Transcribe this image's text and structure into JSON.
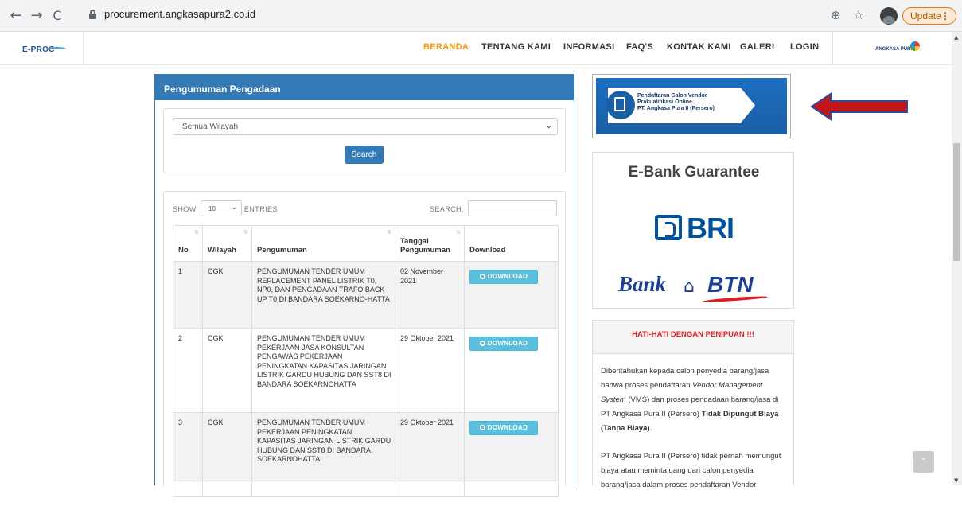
{
  "browser": {
    "back_glyph": "←",
    "forward_glyph": "→",
    "reload_glyph": "C",
    "url": "procurement.angkasapura2.co.id",
    "update_label": "Update",
    "update_menu_glyph": "⋮",
    "zoom_glyph": "⊕",
    "star_glyph": "☆"
  },
  "header": {
    "logo_text": "E-PROC",
    "right_logo_text": "ANGKASA PURA II",
    "menu": [
      {
        "label": "BERANDA",
        "active": true
      },
      {
        "label": "TENTANG KAMI"
      },
      {
        "label": "INFORMASI"
      },
      {
        "label": "FAQ'S"
      },
      {
        "label": "KONTAK KAMI"
      },
      {
        "label": "GALERI"
      },
      {
        "label": "LOGIN"
      }
    ]
  },
  "announcements": {
    "title": "Pengumuman Pengadaan",
    "region_selected": "Semua Wilayah",
    "search_button": "Search",
    "show_label": "SHOW",
    "length_selected": "10",
    "entries_label": "ENTRIES",
    "search_label": "SEARCH:",
    "columns": {
      "no": "No",
      "wilayah": "Wilayah",
      "pengumuman": "Pengumuman",
      "tanggal_1": "Tanggal",
      "tanggal_2": "Pengumuman",
      "download": "Download"
    },
    "download_label": "DOWNLOAD",
    "rows": [
      {
        "no": "1",
        "wilayah": "CGK",
        "pengumuman": "PENGUMUMAN TENDER UMUM REPLACEMENT PANEL LISTRIK T0, NP0, DAN PENGADAAN TRAFO BACK UP T0 DI BANDARA SOEKARNO-HATTA",
        "tanggal": "02 November 2021"
      },
      {
        "no": "2",
        "wilayah": "CGK",
        "pengumuman": "PENGUMUMAN TENDER UMUM PEKERJAAN JASA KONSULTAN PENGAWAS PEKERJAAN PENINGKATAN KAPASITAS JARINGAN LISTRIK GARDU HUBUNG DAN SST8 DI BANDARA SOEKARNOHATTA",
        "tanggal": "29 Oktober 2021"
      },
      {
        "no": "3",
        "wilayah": "CGK",
        "pengumuman": "PENGUMUMAN TENDER UMUM PEKERJAAN PENINGKATAN KAPASITAS JARINGAN LISTRIK GARDU HUBUNG DAN SST8 DI BANDARA SOEKARNOHATTA",
        "tanggal": "29 Oktober 2021"
      }
    ]
  },
  "sidebar": {
    "vendor_banner": {
      "line1": "Pendaftaran Calon Vendor",
      "line2": "Prakualifikasi Online",
      "line3": "PT. Angkasa Pura II (Persero)"
    },
    "ebank_title": "E-Bank Guarantee",
    "bri_text": "BRI",
    "btn_text_1": "Bank",
    "btn_text_2": "BTN",
    "warning": {
      "title": "HATI-HATI DENGAN PENIPUAN !!!",
      "p1_a": "Diberitahukan kepada calon penyedia barang/jasa bahwa proses pendaftaran ",
      "p1_em": "Vendor Management System",
      "p1_b": " (VMS) dan proses pengadaan barang/jasa di PT Angkasa Pura II (Persero) ",
      "p1_strong": "Tidak Dipungut Biaya (Tanpa Biaya)",
      "p1_end": ".",
      "p2": "PT Angkasa Pura II (Persero) tidak pernah memungut biaya atau meminta uang dari calon penyedia barang/jasa dalam proses pendaftaran Vendor"
    }
  },
  "colors": {
    "primary": "#337ab7",
    "accent": "#f39c12",
    "download": "#5bc0de",
    "warning": "#e02020",
    "arrow": "#c0161b"
  },
  "icons": {
    "back_to_top": "⌃"
  }
}
